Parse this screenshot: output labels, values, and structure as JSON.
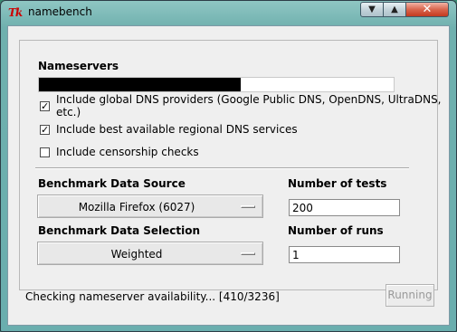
{
  "window": {
    "title": "namebench",
    "icon_text": "Tk",
    "min_glyph": "▼",
    "max_glyph": "▲",
    "close_glyph": "✕"
  },
  "nameservers": {
    "label": "Nameservers",
    "progress_fraction": 0.57
  },
  "options": [
    {
      "label": "Include global DNS providers (Google Public DNS, OpenDNS, UltraDNS, etc.)",
      "checked": true
    },
    {
      "label": "Include best available regional DNS services",
      "checked": true
    },
    {
      "label": "Include censorship checks",
      "checked": false
    }
  ],
  "benchmark_source": {
    "label": "Benchmark Data Source",
    "value": "Mozilla Firefox (6027)"
  },
  "benchmark_selection": {
    "label": "Benchmark Data Selection",
    "value": "Weighted"
  },
  "num_tests": {
    "label": "Number of tests",
    "value": "200"
  },
  "num_runs": {
    "label": "Number of runs",
    "value": "1"
  },
  "status": {
    "text": "Checking nameserver availability... [410/3236]"
  },
  "run_button": {
    "label": "Running",
    "enabled": false
  },
  "colors": {
    "close_button": "#c43a1f",
    "progress_fill": "#000000",
    "disabled_text": "#9a9a9a"
  }
}
